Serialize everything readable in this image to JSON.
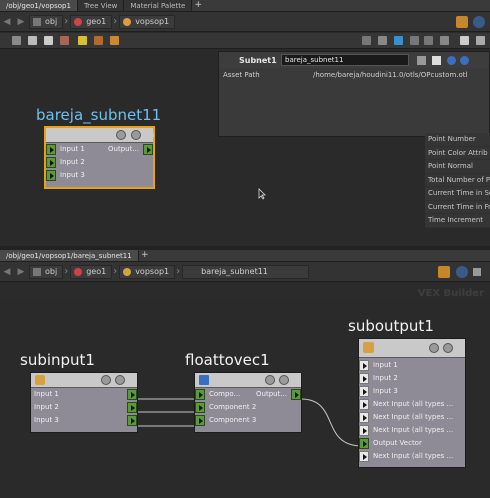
{
  "top": {
    "tabs": [
      {
        "label": "/obj/geo1/vopsop1"
      },
      {
        "label": "Tree View"
      },
      {
        "label": "Material Palette"
      }
    ],
    "add_tab": "+",
    "breadcrumbs": [
      "obj",
      "geo1",
      "vopsop1"
    ],
    "selected_node": {
      "title": "bareja_subnet11",
      "inputs": [
        "Input 1",
        "Input 2",
        "Input 3"
      ],
      "output": "Output..."
    }
  },
  "param_panel": {
    "type_label": "Subnet1",
    "name_value": "bareja_subnet11",
    "rows": [
      {
        "key": "Asset Path",
        "value": "/home/bareja/houdini11.0/otls/OPcustom.otl"
      }
    ]
  },
  "attribute_list": [
    "Point Number",
    "Point Color Attrib",
    "Point Normal",
    "Total Number of Points",
    "Current Time in Seconds",
    "Current Time in Frames",
    "Time Increment"
  ],
  "bottom": {
    "tab": {
      "label": "/obj/geo1/vopsop1/bareja_subnet11"
    },
    "add_tab": "+",
    "breadcrumbs": [
      "obj",
      "geo1",
      "vopsop1",
      "bareja_subnet11"
    ],
    "watermark": "VEX Builder",
    "subinput": {
      "title": "subinput1",
      "outputs": [
        "Input 1",
        "Input 2",
        "Input 3"
      ]
    },
    "floattovec": {
      "title": "floattovec1",
      "inputs": [
        "Compo...",
        "Component 2",
        "Component 3"
      ],
      "output": "Output..."
    },
    "suboutput": {
      "title": "suboutput1",
      "inputs": [
        "Input 1",
        "Input 2",
        "Input 3",
        "Next Input (all types ...",
        "Next Input (all types ...",
        "Next Input (all types ...",
        "Output Vector",
        "Next Input (all types ..."
      ]
    }
  },
  "colors": {
    "selected_title": "#6fc0f0",
    "port_green": "#5a9a3a",
    "node_body": "#8e8a96",
    "selection_border": "#e8a21a"
  }
}
